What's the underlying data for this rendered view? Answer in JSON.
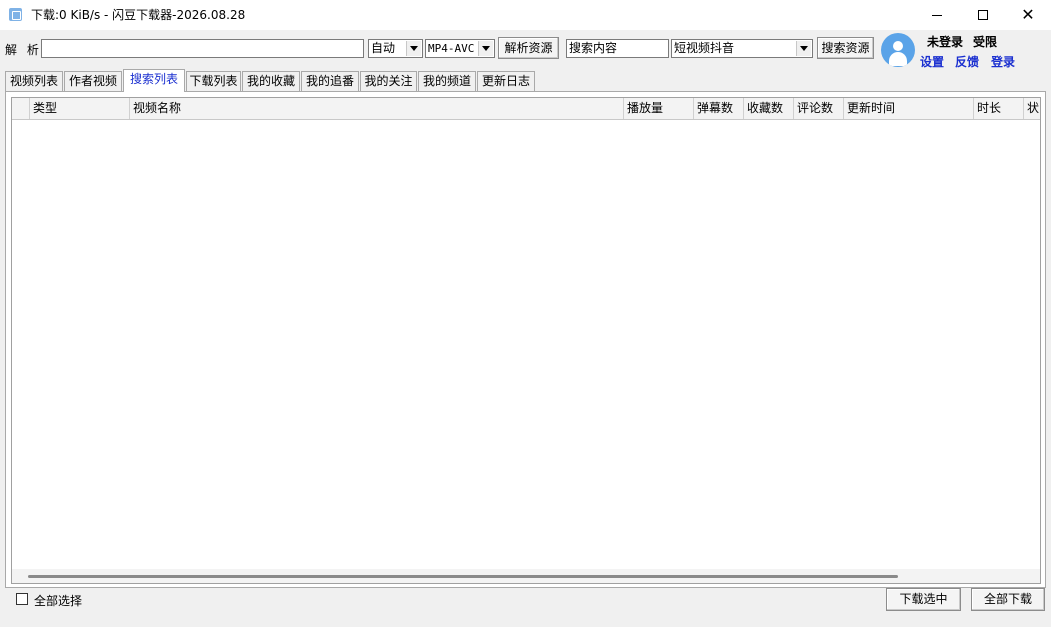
{
  "window": {
    "title": "下载:0 KiB/s - 闪豆下载器-2026.08.28"
  },
  "toolbar": {
    "parse_label": "解 析:",
    "url_value": "",
    "quality_selected": "自动",
    "codec_selected": "MP4-AVC",
    "parse_button": "解析资源",
    "search_value": "搜索内容",
    "source_selected": "短视频抖音",
    "search_button": "搜索资源"
  },
  "user": {
    "status_login": "未登录",
    "status_limit": "受限",
    "settings_link": "设置",
    "feedback_link": "反馈",
    "login_link": "登录"
  },
  "tabs": [
    {
      "label": "视频列表"
    },
    {
      "label": "作者视频"
    },
    {
      "label": "搜索列表"
    },
    {
      "label": "下载列表"
    },
    {
      "label": "我的收藏"
    },
    {
      "label": "我的追番"
    },
    {
      "label": "我的关注"
    },
    {
      "label": "我的频道"
    },
    {
      "label": "更新日志"
    }
  ],
  "active_tab": 2,
  "table": {
    "columns": [
      {
        "label": ""
      },
      {
        "label": "类型"
      },
      {
        "label": "视频名称"
      },
      {
        "label": "播放量"
      },
      {
        "label": "弹幕数"
      },
      {
        "label": "收藏数"
      },
      {
        "label": "评论数"
      },
      {
        "label": "更新时间"
      },
      {
        "label": "时长"
      },
      {
        "label": "状"
      }
    ],
    "rows": []
  },
  "footer": {
    "select_all_label": "全部选择",
    "download_selected": "下载选中",
    "download_all": "全部下载"
  },
  "colors": {
    "accent_link": "#1a2fd0",
    "avatar": "#5aa3e8"
  }
}
